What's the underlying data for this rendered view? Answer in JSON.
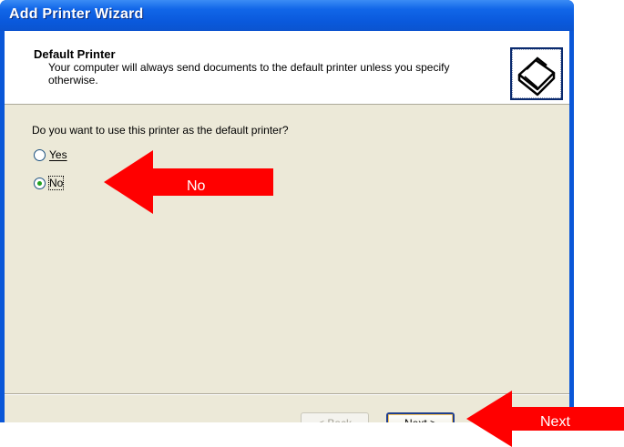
{
  "window": {
    "title": "Add Printer Wizard"
  },
  "header": {
    "title": "Default Printer",
    "subtitle": "Your computer will always send documents to the default printer unless you specify otherwise.",
    "icon": "printer-icon"
  },
  "body": {
    "question": "Do you want to use this printer as the default printer?",
    "options": [
      {
        "label": "Yes",
        "selected": false
      },
      {
        "label": "No",
        "selected": true
      }
    ]
  },
  "buttons": {
    "back": "< Back",
    "next": "Next >"
  },
  "annotations": {
    "no_label": "No",
    "next_label": "Next",
    "arrow_color": "#ff0000"
  }
}
